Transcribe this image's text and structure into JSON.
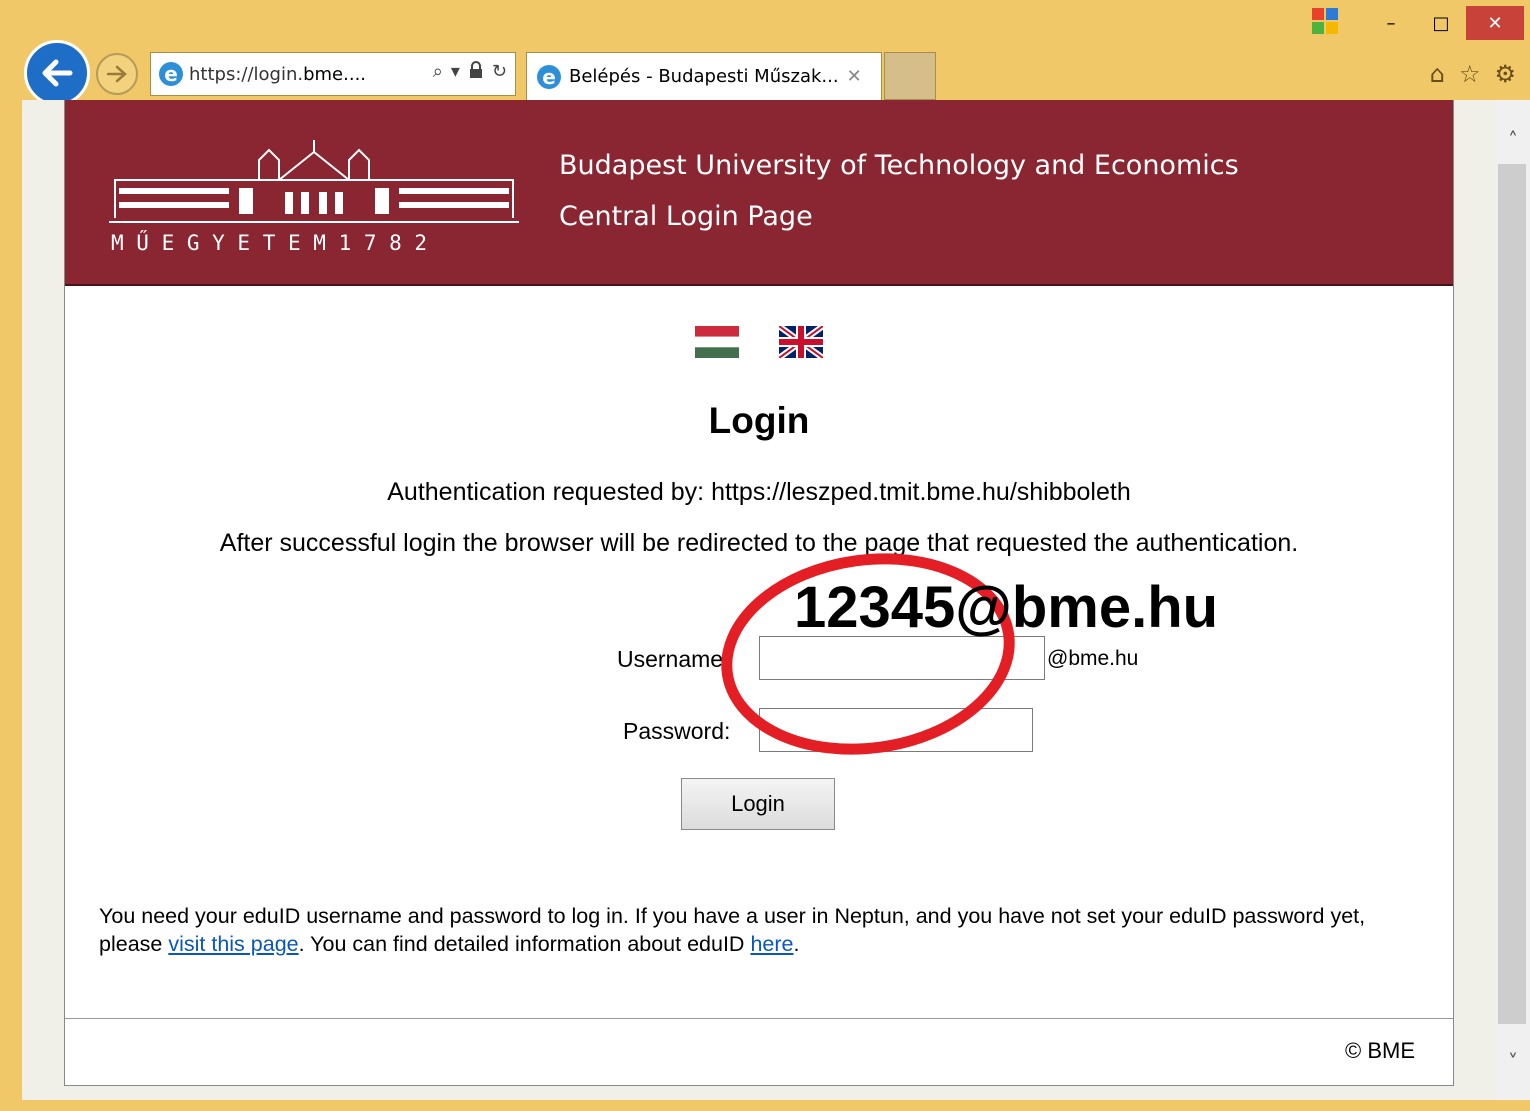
{
  "browser": {
    "window_controls": {
      "minimize": "–",
      "maximize": "□",
      "close": "✕"
    },
    "address_bar": {
      "url_prefix": "https://login.",
      "url_domain": "bme....",
      "search_icon": "⌕",
      "dropdown_icon": "▾",
      "lock_icon": "🔒",
      "refresh_icon": "↻"
    },
    "tab": {
      "title": "Belépés - Budapesti Műszak...",
      "close": "✕"
    },
    "tools": {
      "home": "⌂",
      "favorites": "☆",
      "settings": "⚙"
    },
    "scroll_up": "˄",
    "scroll_down": "˅"
  },
  "header": {
    "logo_text": "M Ű E G Y E T E M  1 7 8 2",
    "university": "Budapest University of Technology and Economics",
    "subtitle": "Central Login Page"
  },
  "main": {
    "title": "Login",
    "auth_requested": "Authentication requested by: https://leszped.tmit.bme.hu/shibboleth",
    "redirect_note": "After successful login the browser will be redirected to the page that requested the authentication.",
    "username_label": "Username:",
    "username_value": "",
    "username_suffix": "@bme.hu",
    "password_label": "Password:",
    "password_value": "",
    "login_button": "Login",
    "info_part1": "You need your eduID username and password to log in. If you have a user in Neptun, and you have not set your eduID password yet, please ",
    "info_link1": "visit this page",
    "info_part2": ". You can find detailed information about eduID ",
    "info_link2": "here",
    "info_part3": "."
  },
  "footer": {
    "copyright": "© BME"
  },
  "annotation": {
    "text": "12345@bme.hu",
    "ring_color": "#e31e24"
  },
  "colors": {
    "brand": "#8a2532",
    "chrome": "#f0c868",
    "link": "#0b57b7"
  }
}
